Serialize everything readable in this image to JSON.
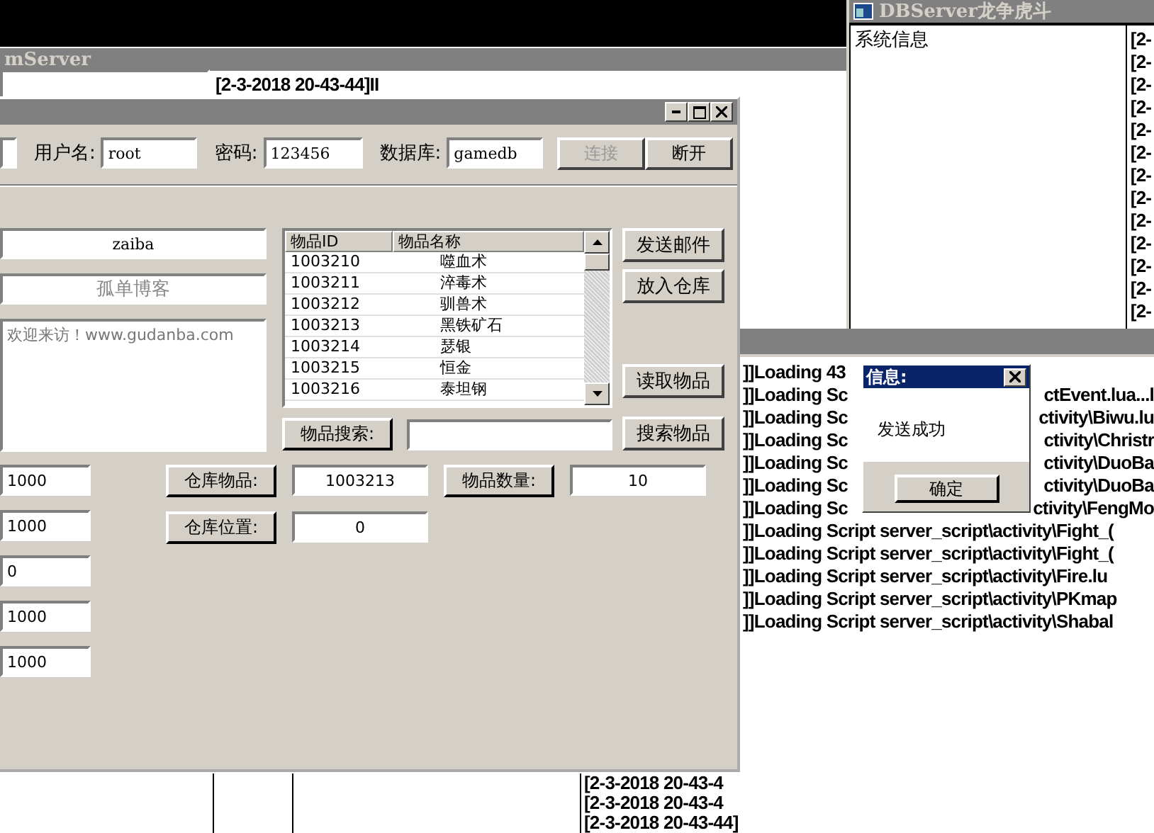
{
  "background_window": {
    "title": "mServer",
    "log_line": "[2-3-2018 20-43-44]II",
    "bottom_log": [
      "[2-3-2018 20-43-4",
      "[2-3-2018 20-43-4",
      "[2-3-2018 20-43-44]"
    ]
  },
  "tool_window": {
    "connection": {
      "fields": [
        {
          "label": "用户名:",
          "value": "root"
        },
        {
          "label": "密码:",
          "value": "123456"
        },
        {
          "label": "数据库:",
          "value": "gamedb"
        }
      ],
      "buttons": [
        {
          "label": "连接",
          "disabled": true
        },
        {
          "label": "断开",
          "disabled": false
        }
      ]
    },
    "sender": {
      "value": "zaiba"
    },
    "title_field": {
      "value": "孤单博客",
      "disabled": true
    },
    "message": "欢迎来访！www.gudanba.com",
    "item_table": {
      "columns": [
        "物品ID",
        "物品名称"
      ],
      "rows": [
        [
          "1003210",
          "噬血术"
        ],
        [
          "1003211",
          "淬毒术"
        ],
        [
          "1003212",
          "驯兽术"
        ],
        [
          "1003213",
          "黑铁矿石"
        ],
        [
          "1003214",
          "瑟银"
        ],
        [
          "1003215",
          "恒金"
        ],
        [
          "1003216",
          "泰坦钢"
        ]
      ]
    },
    "side_buttons": [
      "发送邮件",
      "放入仓库",
      "读取物品",
      "搜索物品"
    ],
    "search_label": "物品搜索:",
    "number_fields": [
      "1000",
      "1000",
      "0",
      "1000",
      "1000"
    ],
    "warehouse": [
      {
        "label": "仓库物品:",
        "value": "1003213"
      },
      {
        "label": "物品数量:",
        "value": "10"
      },
      {
        "label": "仓库位置:",
        "value": "0"
      }
    ]
  },
  "db_server": {
    "title": "DBServer龙争虎斗",
    "panel_title": "系统信息",
    "log_lines": [
      "[2-",
      "[2-",
      "[2-",
      "[2-",
      "[2-",
      "[2-",
      "[2-",
      "[2-",
      "[2-",
      "[2-",
      "[2-",
      "[2-",
      "[2-"
    ]
  },
  "log_window": {
    "lines": [
      {
        "left": "]]Loading 43"
      },
      {
        "left": "]]Loading Sc",
        "right": "ctEvent.lua...l"
      },
      {
        "left": "]]Loading Sc",
        "right": "ctivity\\Biwu.lu"
      },
      {
        "left": "]]Loading Sc",
        "right": "ctivity\\Christr"
      },
      {
        "left": "]]Loading Sc",
        "right": "ctivity\\DuoBa"
      },
      {
        "left": "]]Loading Sc",
        "right": "ctivity\\DuoBa"
      },
      {
        "left": "]]Loading Sc",
        "right": "ctivity\\FengMo"
      },
      {
        "left": "]]Loading Script server_script\\activity\\Fight_("
      },
      {
        "left": "]]Loading Script server_script\\activity\\Fight_("
      },
      {
        "left": "]]Loading Script server_script\\activity\\Fire.lu"
      },
      {
        "left": "]]Loading Script server_script\\activity\\PKmap"
      },
      {
        "left": "]]Loading Script server_script\\activity\\Shabal"
      }
    ]
  },
  "dialog": {
    "title": "信息:",
    "message": "发送成功",
    "button": "确定"
  }
}
